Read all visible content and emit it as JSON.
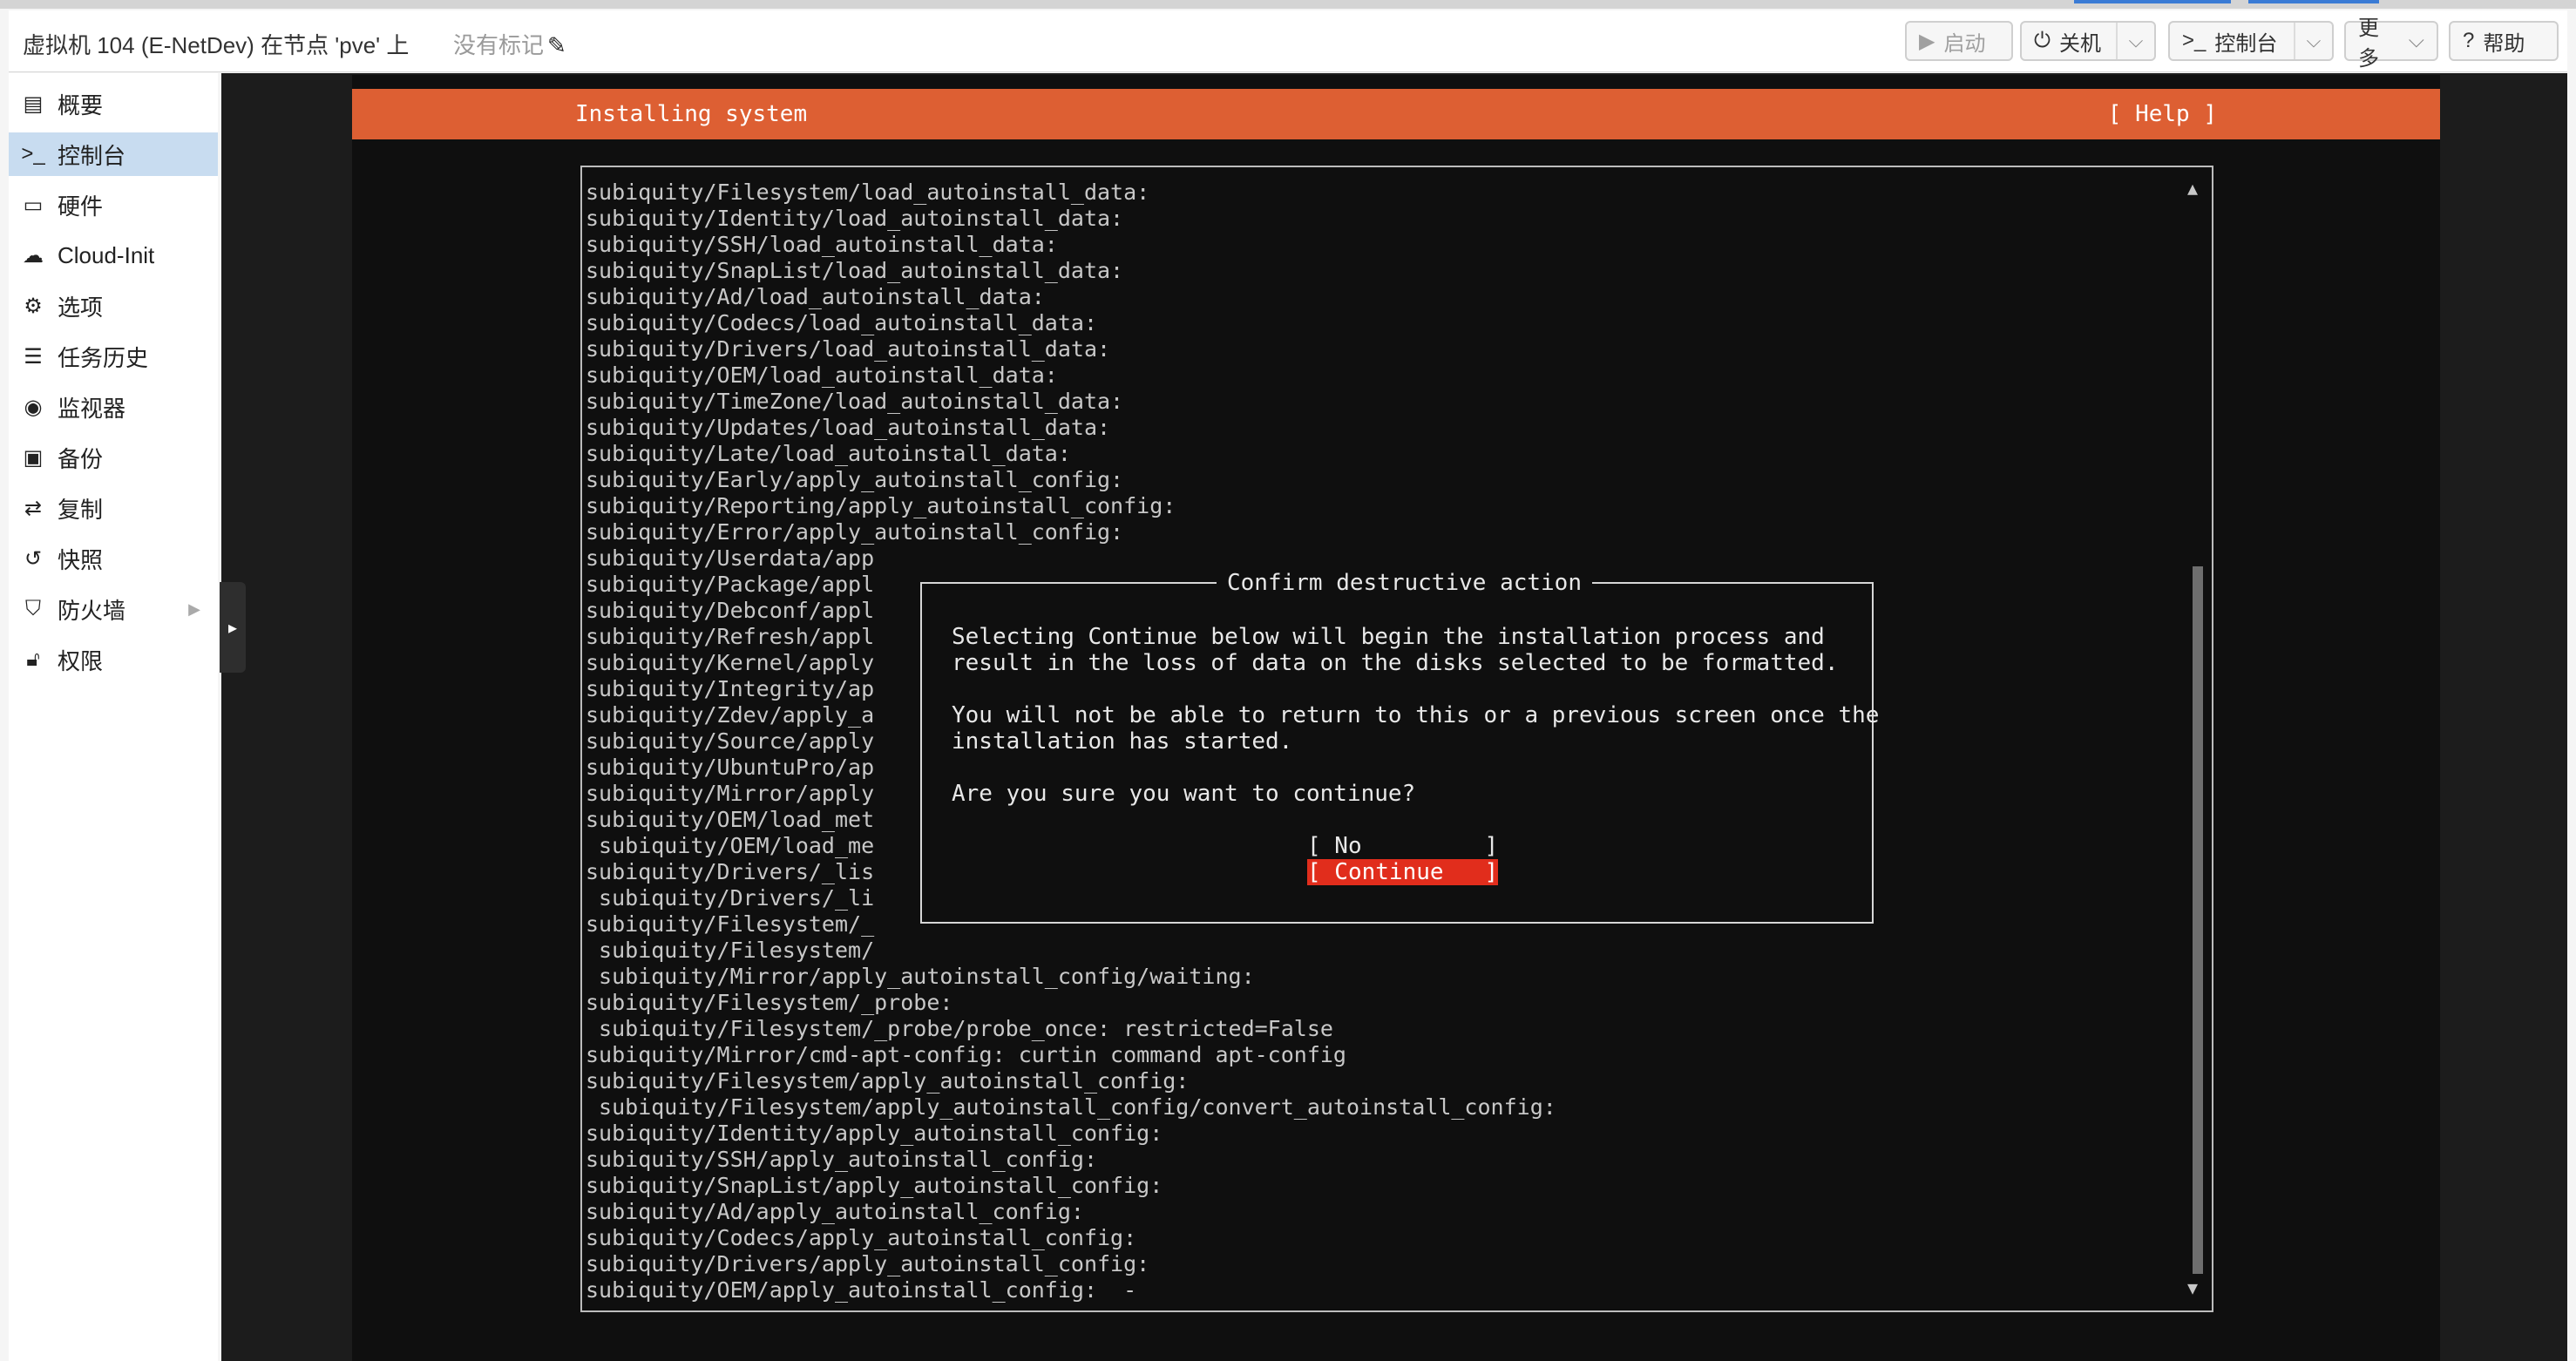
{
  "window": {
    "title": "虚拟机 104 (E-NetDev) 在节点 'pve' 上",
    "tags_label": "没有标记"
  },
  "toolbar": {
    "start": "启动",
    "shutdown": "关机",
    "console": "控制台",
    "more": "更多",
    "help": "帮助"
  },
  "sidebar": {
    "items": [
      {
        "label": "概要",
        "icon": "book-icon"
      },
      {
        "label": "控制台",
        "icon": "terminal-icon"
      },
      {
        "label": "硬件",
        "icon": "monitor-icon"
      },
      {
        "label": "Cloud-Init",
        "icon": "cloud-icon"
      },
      {
        "label": "选项",
        "icon": "gear-icon"
      },
      {
        "label": "任务历史",
        "icon": "list-icon"
      },
      {
        "label": "监视器",
        "icon": "eye-icon"
      },
      {
        "label": "备份",
        "icon": "floppy-icon"
      },
      {
        "label": "复制",
        "icon": "retweet-icon"
      },
      {
        "label": "快照",
        "icon": "history-icon"
      },
      {
        "label": "防火墙",
        "icon": "shield-icon"
      },
      {
        "label": "权限",
        "icon": "unlock-icon"
      }
    ],
    "active_index": 1
  },
  "terminal": {
    "header_title": "Installing system",
    "header_help": "[ Help ]",
    "log_lines": [
      "subiquity/Filesystem/load_autoinstall_data:",
      "subiquity/Identity/load_autoinstall_data:",
      "subiquity/SSH/load_autoinstall_data:",
      "subiquity/SnapList/load_autoinstall_data:",
      "subiquity/Ad/load_autoinstall_data:",
      "subiquity/Codecs/load_autoinstall_data:",
      "subiquity/Drivers/load_autoinstall_data:",
      "subiquity/OEM/load_autoinstall_data:",
      "subiquity/TimeZone/load_autoinstall_data:",
      "subiquity/Updates/load_autoinstall_data:",
      "subiquity/Late/load_autoinstall_data:",
      "subiquity/Early/apply_autoinstall_config:",
      "subiquity/Reporting/apply_autoinstall_config:",
      "subiquity/Error/apply_autoinstall_config:",
      "subiquity/Userdata/app",
      "subiquity/Package/appl",
      "subiquity/Debconf/appl",
      "subiquity/Refresh/appl",
      "subiquity/Kernel/apply",
      "subiquity/Integrity/ap",
      "subiquity/Zdev/apply_a",
      "subiquity/Source/apply",
      "subiquity/UbuntuPro/ap",
      "subiquity/Mirror/apply",
      "subiquity/OEM/load_met",
      " subiquity/OEM/load_me",
      "subiquity/Drivers/_lis",
      " subiquity/Drivers/_li",
      "subiquity/Filesystem/_",
      " subiquity/Filesystem/",
      " subiquity/Mirror/apply_autoinstall_config/waiting:",
      "subiquity/Filesystem/_probe:",
      " subiquity/Filesystem/_probe/probe_once: restricted=False",
      "subiquity/Mirror/cmd-apt-config: curtin command apt-config",
      "subiquity/Filesystem/apply_autoinstall_config:",
      " subiquity/Filesystem/apply_autoinstall_config/convert_autoinstall_config:",
      "subiquity/Identity/apply_autoinstall_config:",
      "subiquity/SSH/apply_autoinstall_config:",
      "subiquity/SnapList/apply_autoinstall_config:",
      "subiquity/Ad/apply_autoinstall_config:",
      "subiquity/Codecs/apply_autoinstall_config:",
      "subiquity/Drivers/apply_autoinstall_config:",
      "subiquity/OEM/apply_autoinstall_config:  -"
    ]
  },
  "dialog": {
    "title": "Confirm destructive action",
    "body": "Selecting Continue below will begin the installation process and\nresult in the loss of data on the disks selected to be formatted.\n\nYou will not be able to return to this or a previous screen once the\ninstallation has started.\n\nAre you sure you want to continue?",
    "no_button": "[ No         ]",
    "continue_button": "[ Continue   ]",
    "selected": "continue"
  },
  "colors": {
    "header_orange": "#dd5f33",
    "selected_red": "#e12d1c",
    "sidebar_active": "#c8dcf0"
  }
}
